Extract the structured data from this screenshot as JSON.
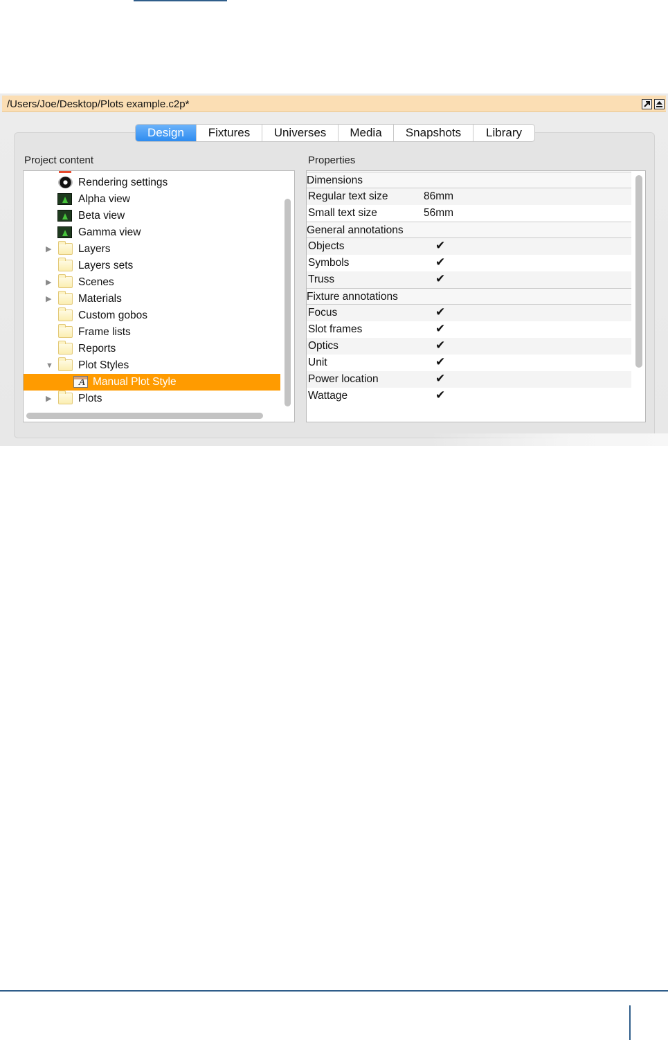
{
  "window": {
    "title_path": "/Users/Joe/Desktop/Plots example.c2p*",
    "title_buttons": [
      {
        "icon": "pop-out-icon"
      },
      {
        "icon": "eject-icon"
      }
    ],
    "title_bar_color": "#fbdeb4"
  },
  "tabs": [
    {
      "label": "Design",
      "active": true
    },
    {
      "label": "Fixtures",
      "active": false
    },
    {
      "label": "Universes",
      "active": false
    },
    {
      "label": "Media",
      "active": false
    },
    {
      "label": "Snapshots",
      "active": false
    },
    {
      "label": "Library",
      "active": false
    }
  ],
  "project_content": {
    "label": "Project content",
    "items": [
      {
        "label": "Rendering settings",
        "icon": "rendering-settings-icon",
        "expandable": false,
        "expanded": false,
        "selected": false
      },
      {
        "label": "Alpha view",
        "icon": "view-icon",
        "expandable": false,
        "expanded": false,
        "selected": false
      },
      {
        "label": "Beta view",
        "icon": "view-icon",
        "expandable": false,
        "expanded": false,
        "selected": false
      },
      {
        "label": "Gamma view",
        "icon": "view-icon",
        "expandable": false,
        "expanded": false,
        "selected": false
      },
      {
        "label": "Layers",
        "icon": "folder-icon",
        "expandable": true,
        "expanded": false,
        "selected": false
      },
      {
        "label": "Layers sets",
        "icon": "folder-icon",
        "expandable": false,
        "expanded": false,
        "selected": false
      },
      {
        "label": "Scenes",
        "icon": "folder-icon",
        "expandable": true,
        "expanded": false,
        "selected": false
      },
      {
        "label": "Materials",
        "icon": "folder-icon",
        "expandable": true,
        "expanded": false,
        "selected": false
      },
      {
        "label": "Custom gobos",
        "icon": "folder-icon",
        "expandable": false,
        "expanded": false,
        "selected": false
      },
      {
        "label": "Frame lists",
        "icon": "folder-icon",
        "expandable": false,
        "expanded": false,
        "selected": false
      },
      {
        "label": "Reports",
        "icon": "folder-icon",
        "expandable": false,
        "expanded": false,
        "selected": false
      },
      {
        "label": "Plot Styles",
        "icon": "folder-icon",
        "expandable": true,
        "expanded": true,
        "selected": false
      },
      {
        "label": "Manual Plot Style",
        "icon": "plot-style-icon",
        "expandable": false,
        "expanded": false,
        "selected": true,
        "child": true
      },
      {
        "label": "Plots",
        "icon": "folder-icon",
        "expandable": true,
        "expanded": false,
        "selected": false
      }
    ],
    "selection_color": "#ff9b00"
  },
  "properties": {
    "label": "Properties",
    "rows": [
      {
        "kind": "group",
        "name": "Dimensions"
      },
      {
        "kind": "value",
        "name": "Regular text size",
        "value": "86mm"
      },
      {
        "kind": "value",
        "name": "Small text size",
        "value": "56mm"
      },
      {
        "kind": "group",
        "name": "General annotations"
      },
      {
        "kind": "check",
        "name": "Objects",
        "value": "✔"
      },
      {
        "kind": "check",
        "name": "Symbols",
        "value": "✔"
      },
      {
        "kind": "check",
        "name": "Truss",
        "value": "✔"
      },
      {
        "kind": "group",
        "name": "Fixture annotations"
      },
      {
        "kind": "check",
        "name": "Focus",
        "value": "✔"
      },
      {
        "kind": "check",
        "name": "Slot frames",
        "value": "✔"
      },
      {
        "kind": "check",
        "name": "Optics",
        "value": "✔"
      },
      {
        "kind": "check",
        "name": "Unit",
        "value": "✔"
      },
      {
        "kind": "check",
        "name": "Power location",
        "value": "✔"
      },
      {
        "kind": "check",
        "name": "Wattage",
        "value": "✔"
      }
    ]
  },
  "colors": {
    "active_tab": "#2e8cf0",
    "page_rule": "#2f5d8a"
  }
}
